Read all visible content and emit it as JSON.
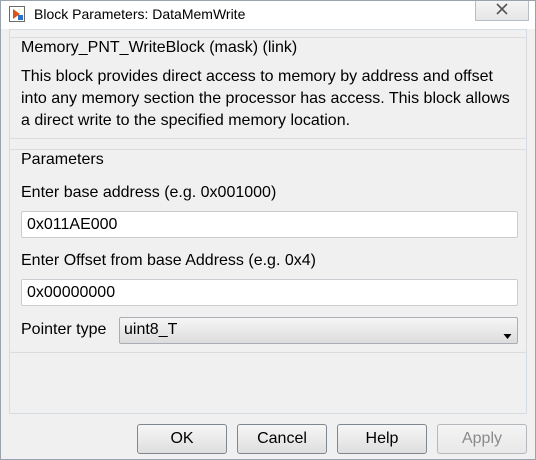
{
  "window": {
    "title": "Block Parameters: DataMemWrite",
    "close_icon": "close-x-icon"
  },
  "description_group": {
    "heading": "Memory_PNT_WriteBlock (mask) (link)",
    "text": "This block provides direct access to memory by address and offset into any memory section the processor has access.  This block allows a direct write to the specified memory location."
  },
  "parameters_group": {
    "heading": "Parameters",
    "base_address": {
      "label": "Enter base address (e.g. 0x001000)",
      "value": "0x011AE000"
    },
    "offset": {
      "label": "Enter Offset from base Address (e.g. 0x4)",
      "value": "0x00000000"
    },
    "pointer_type": {
      "label": "Pointer type",
      "selected": "uint8_T"
    }
  },
  "buttons": {
    "ok": "OK",
    "cancel": "Cancel",
    "help": "Help",
    "apply": "Apply"
  }
}
